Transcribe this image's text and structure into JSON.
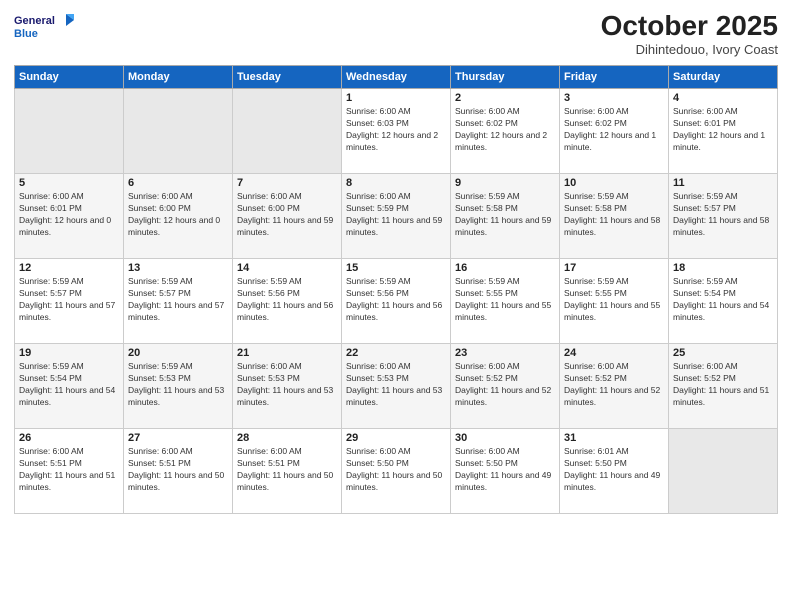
{
  "header": {
    "logo_line1": "General",
    "logo_line2": "Blue",
    "month": "October 2025",
    "location": "Dihintedouo, Ivory Coast"
  },
  "weekdays": [
    "Sunday",
    "Monday",
    "Tuesday",
    "Wednesday",
    "Thursday",
    "Friday",
    "Saturday"
  ],
  "weeks": [
    [
      {
        "day": "",
        "empty": true
      },
      {
        "day": "",
        "empty": true
      },
      {
        "day": "",
        "empty": true
      },
      {
        "day": "1",
        "sunrise": "6:00 AM",
        "sunset": "6:03 PM",
        "daylight": "12 hours and 2 minutes."
      },
      {
        "day": "2",
        "sunrise": "6:00 AM",
        "sunset": "6:02 PM",
        "daylight": "12 hours and 2 minutes."
      },
      {
        "day": "3",
        "sunrise": "6:00 AM",
        "sunset": "6:02 PM",
        "daylight": "12 hours and 1 minute."
      },
      {
        "day": "4",
        "sunrise": "6:00 AM",
        "sunset": "6:01 PM",
        "daylight": "12 hours and 1 minute."
      }
    ],
    [
      {
        "day": "5",
        "sunrise": "6:00 AM",
        "sunset": "6:01 PM",
        "daylight": "12 hours and 0 minutes."
      },
      {
        "day": "6",
        "sunrise": "6:00 AM",
        "sunset": "6:00 PM",
        "daylight": "12 hours and 0 minutes."
      },
      {
        "day": "7",
        "sunrise": "6:00 AM",
        "sunset": "6:00 PM",
        "daylight": "11 hours and 59 minutes."
      },
      {
        "day": "8",
        "sunrise": "6:00 AM",
        "sunset": "5:59 PM",
        "daylight": "11 hours and 59 minutes."
      },
      {
        "day": "9",
        "sunrise": "5:59 AM",
        "sunset": "5:58 PM",
        "daylight": "11 hours and 59 minutes."
      },
      {
        "day": "10",
        "sunrise": "5:59 AM",
        "sunset": "5:58 PM",
        "daylight": "11 hours and 58 minutes."
      },
      {
        "day": "11",
        "sunrise": "5:59 AM",
        "sunset": "5:57 PM",
        "daylight": "11 hours and 58 minutes."
      }
    ],
    [
      {
        "day": "12",
        "sunrise": "5:59 AM",
        "sunset": "5:57 PM",
        "daylight": "11 hours and 57 minutes."
      },
      {
        "day": "13",
        "sunrise": "5:59 AM",
        "sunset": "5:57 PM",
        "daylight": "11 hours and 57 minutes."
      },
      {
        "day": "14",
        "sunrise": "5:59 AM",
        "sunset": "5:56 PM",
        "daylight": "11 hours and 56 minutes."
      },
      {
        "day": "15",
        "sunrise": "5:59 AM",
        "sunset": "5:56 PM",
        "daylight": "11 hours and 56 minutes."
      },
      {
        "day": "16",
        "sunrise": "5:59 AM",
        "sunset": "5:55 PM",
        "daylight": "11 hours and 55 minutes."
      },
      {
        "day": "17",
        "sunrise": "5:59 AM",
        "sunset": "5:55 PM",
        "daylight": "11 hours and 55 minutes."
      },
      {
        "day": "18",
        "sunrise": "5:59 AM",
        "sunset": "5:54 PM",
        "daylight": "11 hours and 54 minutes."
      }
    ],
    [
      {
        "day": "19",
        "sunrise": "5:59 AM",
        "sunset": "5:54 PM",
        "daylight": "11 hours and 54 minutes."
      },
      {
        "day": "20",
        "sunrise": "5:59 AM",
        "sunset": "5:53 PM",
        "daylight": "11 hours and 53 minutes."
      },
      {
        "day": "21",
        "sunrise": "6:00 AM",
        "sunset": "5:53 PM",
        "daylight": "11 hours and 53 minutes."
      },
      {
        "day": "22",
        "sunrise": "6:00 AM",
        "sunset": "5:53 PM",
        "daylight": "11 hours and 53 minutes."
      },
      {
        "day": "23",
        "sunrise": "6:00 AM",
        "sunset": "5:52 PM",
        "daylight": "11 hours and 52 minutes."
      },
      {
        "day": "24",
        "sunrise": "6:00 AM",
        "sunset": "5:52 PM",
        "daylight": "11 hours and 52 minutes."
      },
      {
        "day": "25",
        "sunrise": "6:00 AM",
        "sunset": "5:52 PM",
        "daylight": "11 hours and 51 minutes."
      }
    ],
    [
      {
        "day": "26",
        "sunrise": "6:00 AM",
        "sunset": "5:51 PM",
        "daylight": "11 hours and 51 minutes."
      },
      {
        "day": "27",
        "sunrise": "6:00 AM",
        "sunset": "5:51 PM",
        "daylight": "11 hours and 50 minutes."
      },
      {
        "day": "28",
        "sunrise": "6:00 AM",
        "sunset": "5:51 PM",
        "daylight": "11 hours and 50 minutes."
      },
      {
        "day": "29",
        "sunrise": "6:00 AM",
        "sunset": "5:50 PM",
        "daylight": "11 hours and 50 minutes."
      },
      {
        "day": "30",
        "sunrise": "6:00 AM",
        "sunset": "5:50 PM",
        "daylight": "11 hours and 49 minutes."
      },
      {
        "day": "31",
        "sunrise": "6:01 AM",
        "sunset": "5:50 PM",
        "daylight": "11 hours and 49 minutes."
      },
      {
        "day": "",
        "empty": true
      }
    ]
  ],
  "labels": {
    "sunrise": "Sunrise:",
    "sunset": "Sunset:",
    "daylight": "Daylight:"
  }
}
